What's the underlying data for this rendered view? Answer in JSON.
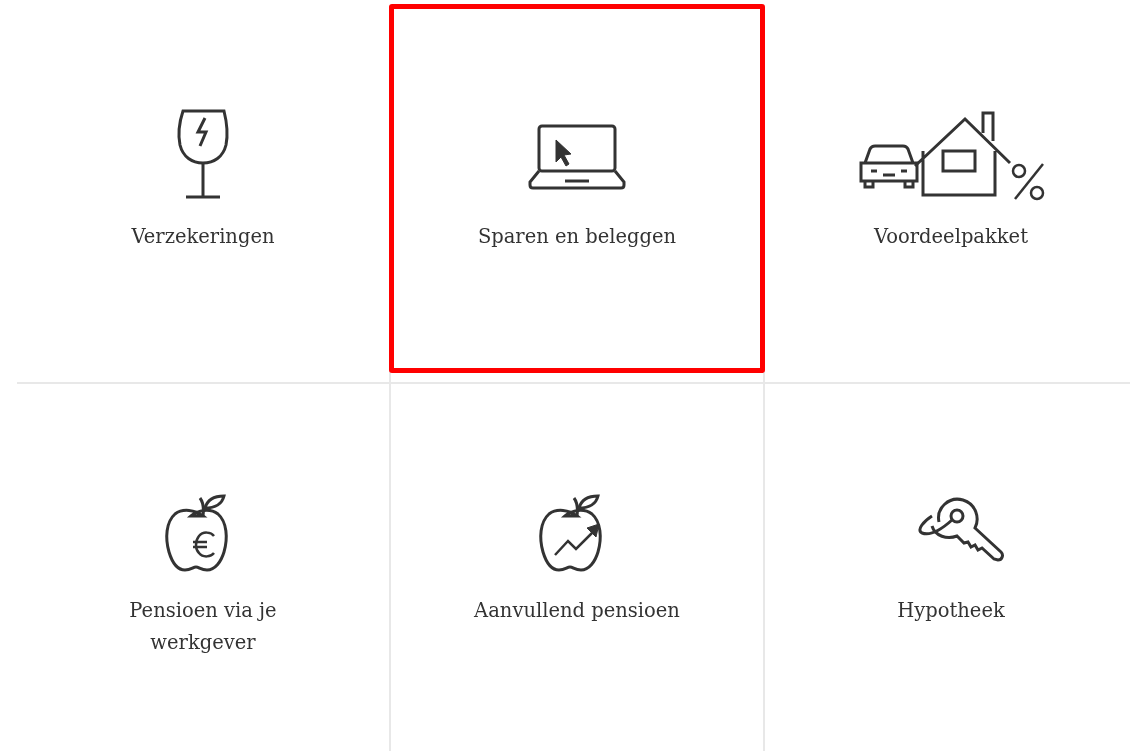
{
  "tiles": [
    {
      "label": "Verzekeringen",
      "highlighted": false
    },
    {
      "label": "Sparen en beleggen",
      "highlighted": true
    },
    {
      "label": "Voordeelpakket",
      "highlighted": false
    },
    {
      "label": "Pensioen via je werkgever",
      "highlighted": false
    },
    {
      "label": "Aanvullend pensioen",
      "highlighted": false
    },
    {
      "label": "Hypotheek",
      "highlighted": false
    }
  ]
}
